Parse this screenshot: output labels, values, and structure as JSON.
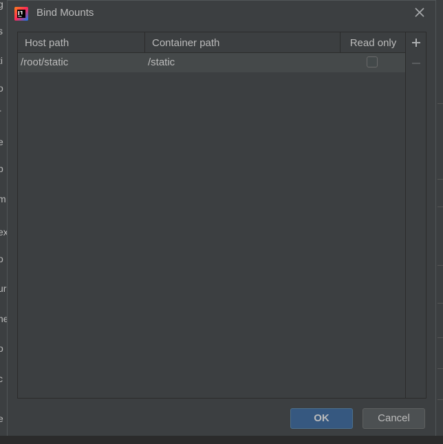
{
  "dialog": {
    "title": "Bind Mounts",
    "app_icon": "intellij-idea-icon",
    "close_icon": "close-icon"
  },
  "table": {
    "columns": {
      "host_path": "Host path",
      "container_path": "Container path",
      "read_only": "Read only"
    },
    "rows": [
      {
        "host_path": "/root/static",
        "container_path": "/static",
        "read_only": false
      }
    ]
  },
  "toolbar": {
    "add_icon": "plus-icon",
    "remove_icon": "minus-icon"
  },
  "buttons": {
    "ok": "OK",
    "cancel": "Cancel"
  },
  "background": {
    "fragments": [
      "g",
      "s",
      "ti",
      "o",
      "r",
      "e",
      "p",
      "m",
      "ex",
      "o",
      "ur",
      "ne",
      "o",
      "c",
      "e"
    ]
  },
  "colors": {
    "dialog_bg": "#3c3f41",
    "selected_row": "#45494a",
    "ok_button": "#365880",
    "text": "#bbbbbb"
  }
}
